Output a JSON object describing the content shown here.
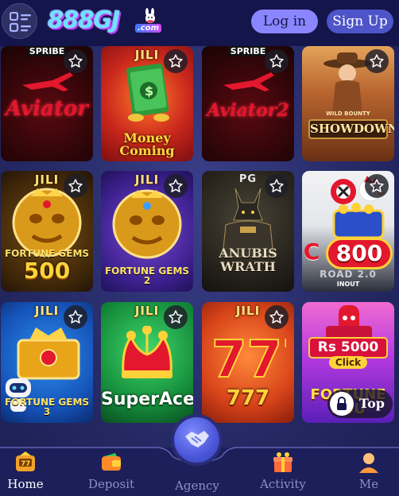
{
  "header": {
    "logo_text": "888GJ",
    "logo_tld": ".com",
    "login_label": "Log in",
    "signup_label": "Sign Up"
  },
  "games": [
    {
      "provider": "SPRIBE",
      "title": "Aviator"
    },
    {
      "provider": "JILI",
      "title": "Money Coming"
    },
    {
      "provider": "SPRIBE",
      "title": "Aviator2"
    },
    {
      "provider": "",
      "title": "SHOWDOWN",
      "subtitle": "WILD BOUNTY"
    },
    {
      "provider": "JILI",
      "title": "FORTUNE GEMS",
      "subtitle": "500"
    },
    {
      "provider": "JILI",
      "title": "FORTUNE GEMS 2"
    },
    {
      "provider": "PG",
      "title": "ANUBIS WRATH"
    },
    {
      "provider": "",
      "title": "C",
      "badge": "800",
      "subtitle": "ROAD 2.0",
      "brand": "INOUT"
    },
    {
      "provider": "JILI",
      "title": "FORTUNE GEMS 3"
    },
    {
      "provider": "JILI",
      "title": "SuperAce"
    },
    {
      "provider": "JILI",
      "title": "777"
    },
    {
      "provider": "",
      "title": "Rs 5000",
      "button": "Click",
      "subtitle": "FORTUNE ROU"
    }
  ],
  "top_button_label": "Top",
  "bottom_nav": {
    "home": "Home",
    "deposit": "Deposit",
    "agency": "Agency",
    "activity": "Activity",
    "me": "Me"
  },
  "colors": {
    "header_bg": "#14154a",
    "login_bg": "#8a86ff",
    "signup_bg": "#4d55c9",
    "nav_bg": "#1d1f5a",
    "page_bg": "#2b2f6e"
  }
}
